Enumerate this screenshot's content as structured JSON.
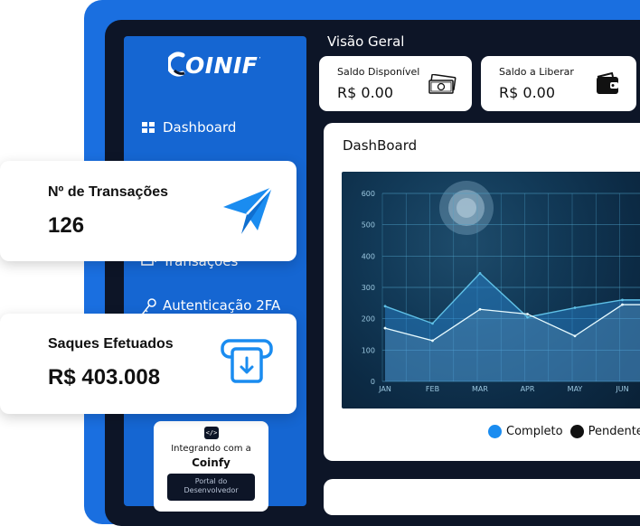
{
  "brand": {
    "logo_text": "COINIFY"
  },
  "sidebar": {
    "items": [
      {
        "label": "Dashboard",
        "icon": "grid-icon"
      },
      {
        "label": "Transações",
        "icon": "transactions-icon"
      },
      {
        "label": "Autenticação 2FA",
        "icon": "key-icon"
      }
    ],
    "dev_card": {
      "line1": "Integrando com a",
      "line2": "Coinfy",
      "button": "Portal do Desenvolvedor",
      "code_icon": "</>"
    }
  },
  "header": {
    "title": "Visão Geral"
  },
  "stats": [
    {
      "label": "Saldo Disponível",
      "value": "R$ 0.00",
      "icon": "cash-icon"
    },
    {
      "label": "Saldo a Liberar",
      "value": "R$ 0.00",
      "icon": "wallet-icon"
    }
  ],
  "dashboard": {
    "title": "DashBoard"
  },
  "chart_data": {
    "type": "area",
    "categories": [
      "JAN",
      "FEB",
      "MAR",
      "APR",
      "MAY",
      "JUN"
    ],
    "yticks": [
      "0",
      "100",
      "200",
      "300",
      "400",
      "500",
      "600"
    ],
    "ylim": [
      0,
      600
    ],
    "grid": true,
    "series": [
      {
        "name": "Completo",
        "values": [
          240,
          185,
          345,
          205,
          235,
          260
        ],
        "color": "#2a8bdc"
      },
      {
        "name": "Pendente",
        "values": [
          170,
          130,
          230,
          215,
          145,
          245
        ],
        "color": "#d9f1f6"
      }
    ],
    "legend": [
      {
        "label": "Completo",
        "color": "#1a8cf0"
      },
      {
        "label": "Pendente",
        "color": "#111111"
      },
      {
        "label": "",
        "color": "#e53935"
      }
    ]
  },
  "floating": {
    "transactions": {
      "label": "Nº de Transações",
      "value": "126",
      "icon": "paper-plane-icon"
    },
    "withdrawals": {
      "label": "Saques Efetuados",
      "value": "R$ 403.008",
      "icon": "atm-withdraw-icon"
    }
  }
}
